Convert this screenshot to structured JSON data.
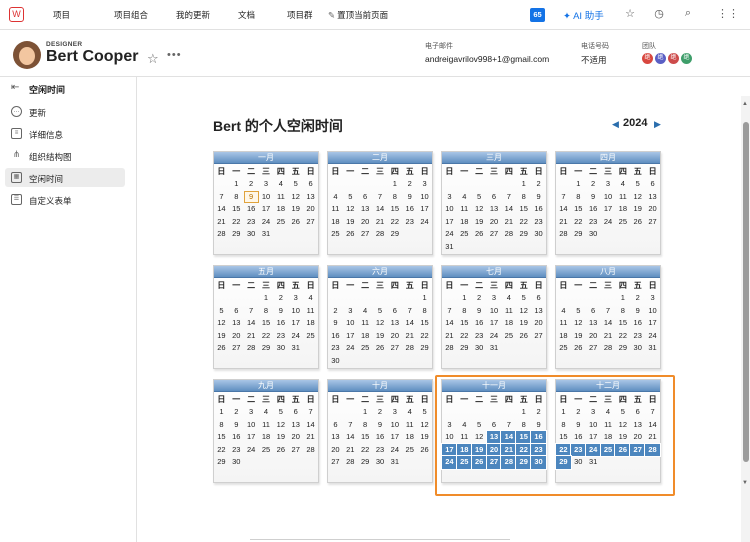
{
  "topnav": {
    "logo": "W",
    "items": [
      "项目",
      "项目组合",
      "我的更新",
      "文档",
      "项目群",
      "置顶当前页面"
    ],
    "badge_count": "65",
    "ai_label": "AI 助手"
  },
  "profile": {
    "role": "DESIGNER",
    "name": "Bert Cooper",
    "email_label": "电子邮件",
    "email": "andreigavrilov998+1@gmail.com",
    "phone_label": "电话号码",
    "phone": "不适用",
    "team_label": "团队",
    "team_avatar_text": "绝",
    "team_colors": [
      "#d8473f",
      "#5a5fc4",
      "#cd4b4b",
      "#3e9e6a"
    ]
  },
  "sidebar": {
    "title": "空闲时间",
    "items": [
      {
        "label": "更新",
        "icon": "speech-bubble-icon"
      },
      {
        "label": "详细信息",
        "icon": "document-icon"
      },
      {
        "label": "组织结构图",
        "icon": "org-chart-icon"
      },
      {
        "label": "空闲时间",
        "icon": "calendar-icon"
      },
      {
        "label": "自定义表单",
        "icon": "form-icon"
      }
    ]
  },
  "calendar": {
    "title": "Bert 的个人空闲时间",
    "year": "2024",
    "weekdays": [
      "日",
      "一",
      "二",
      "三",
      "四",
      "五",
      "日"
    ],
    "months": [
      {
        "name": "一月",
        "start": 1,
        "days": 31,
        "today": 9
      },
      {
        "name": "二月",
        "start": 4,
        "days": 29
      },
      {
        "name": "三月",
        "start": 5,
        "days": 31
      },
      {
        "name": "四月",
        "start": 1,
        "days": 30
      },
      {
        "name": "五月",
        "start": 3,
        "days": 31
      },
      {
        "name": "六月",
        "start": 6,
        "days": 30
      },
      {
        "name": "七月",
        "start": 1,
        "days": 31
      },
      {
        "name": "八月",
        "start": 4,
        "days": 31
      },
      {
        "name": "九月",
        "start": 0,
        "days": 30
      },
      {
        "name": "十月",
        "start": 2,
        "days": 31
      },
      {
        "name": "十一月",
        "start": 5,
        "days": 30,
        "off_from": 13,
        "off_to": 30
      },
      {
        "name": "十二月",
        "start": 0,
        "days": 31,
        "off_from": 22,
        "off_to": 29
      }
    ]
  },
  "colors": {
    "accent": "#1473e6",
    "month_header": "#5f8fc0",
    "time_off": "#4c86be",
    "highlight_box": "#f08c2a"
  }
}
